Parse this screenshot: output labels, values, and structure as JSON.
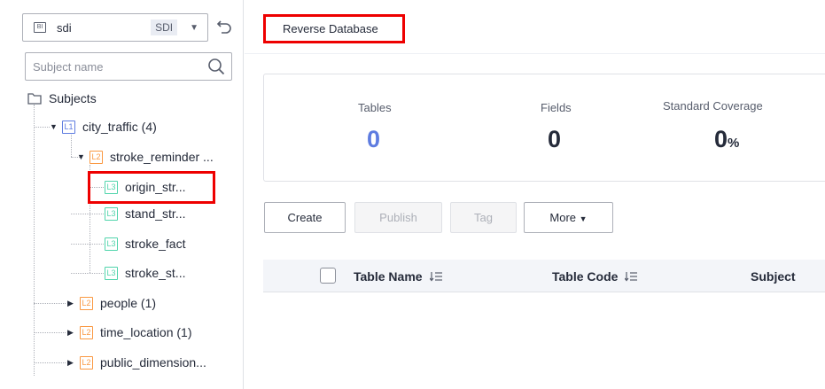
{
  "workspace": {
    "name": "sdi",
    "code": "SDI",
    "icon_text": "BI"
  },
  "search": {
    "placeholder": "Subject name"
  },
  "tree": {
    "root": "Subjects",
    "items": [
      {
        "level": "L1",
        "label": "city_traffic (4)",
        "expanded": true
      },
      {
        "level": "L2",
        "label": "stroke_reminder ...",
        "expanded": true
      },
      {
        "level": "L3",
        "label": "origin_str...",
        "selected": true
      },
      {
        "level": "L3",
        "label": "stand_str..."
      },
      {
        "level": "L3",
        "label": "stroke_fact"
      },
      {
        "level": "L3",
        "label": "stroke_st..."
      },
      {
        "level": "L2",
        "label": "people (1)",
        "expanded": false
      },
      {
        "level": "L2",
        "label": "time_location (1)",
        "expanded": false
      },
      {
        "level": "L2",
        "label": "public_dimension...",
        "expanded": false
      }
    ]
  },
  "toolbar": {
    "reverse_database": "Reverse Database"
  },
  "stats": {
    "tables_label": "Tables",
    "tables_value": "0",
    "fields_label": "Fields",
    "fields_value": "0",
    "coverage_label": "Standard Coverage",
    "coverage_value": "0",
    "coverage_unit": "%"
  },
  "actions": {
    "create": "Create",
    "publish": "Publish",
    "tag": "Tag",
    "more": "More"
  },
  "table": {
    "columns": [
      "Table Name",
      "Table Code",
      "Subject"
    ]
  },
  "colors": {
    "accent": "#5e7ce0",
    "highlight": "#ee0000",
    "l1": "#5e7ce0",
    "l2": "#fa9841",
    "l3": "#50d4ab"
  }
}
